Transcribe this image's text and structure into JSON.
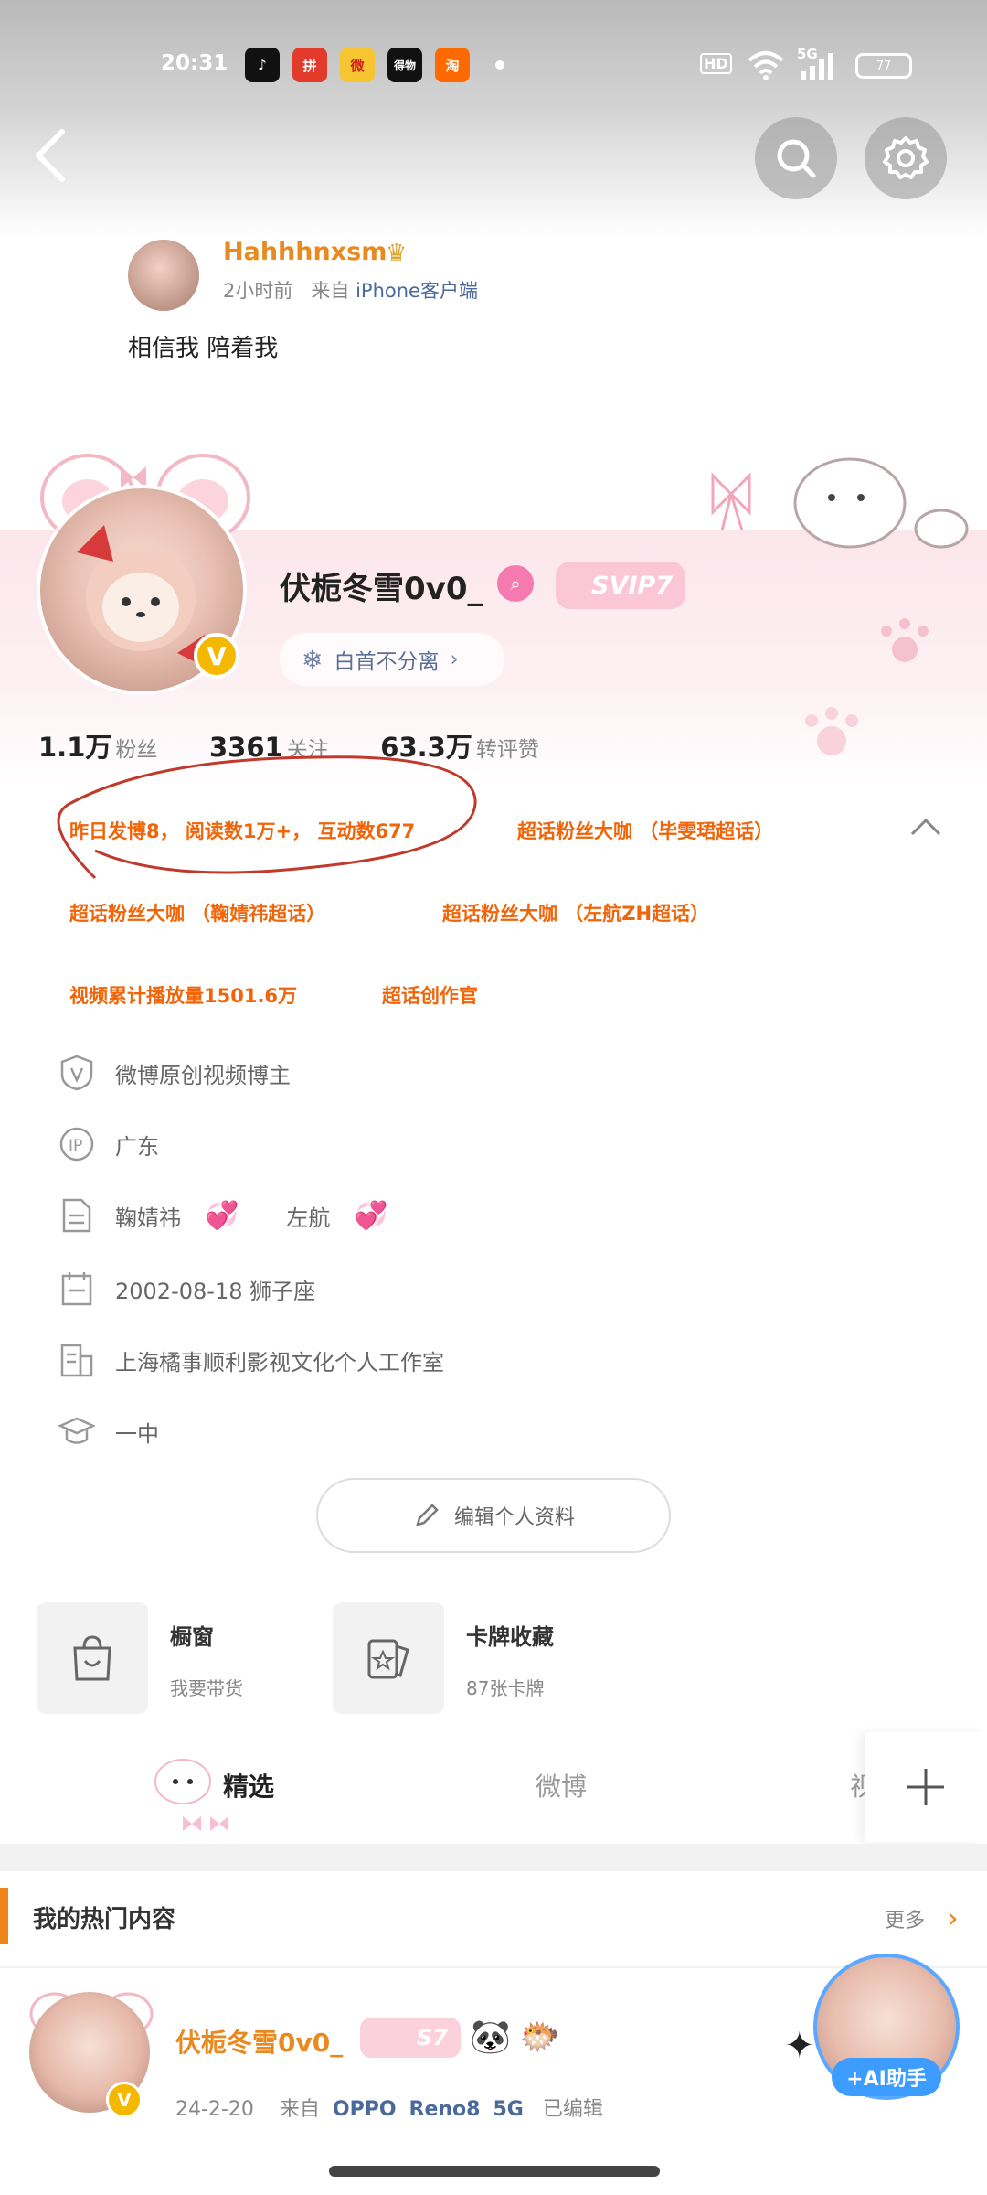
{
  "status_bar": {
    "time": "20:31",
    "apps": [
      "douyin",
      "pdd",
      "weibo",
      "dewu",
      "taobao"
    ],
    "app_glyphs": [
      "♪",
      "拼",
      "微",
      "得物",
      "淘"
    ],
    "network": "5G",
    "hd": "HD",
    "battery": "77"
  },
  "nav": {
    "back_icon": "back-arrow-icon",
    "search_icon": "search-icon",
    "settings_icon": "gear-icon"
  },
  "post_preview": {
    "author": "Hahhhnxsm",
    "time": "2小时前",
    "from_prefix": "来自",
    "client": "iPhone客户端",
    "text": "相信我 陪着我"
  },
  "profile": {
    "name": "伏栀冬雪0v0_",
    "svip": "SVIP7",
    "verified": "V",
    "pill": "白首不分离",
    "fans_num": "1.1万",
    "fans_label": "粉丝",
    "follow_num": "3361",
    "follow_label": "关注",
    "likes_num": "63.3万",
    "likes_label": "转评赞"
  },
  "tags": {
    "t1": "昨日发博8， 阅读数1万+， 互动数677",
    "t2": "超话粉丝大咖 （毕雯珺超话）",
    "t3": "超话粉丝大咖 （鞠婧祎超话）",
    "t4": "超话粉丝大咖 （左航ZH超话）",
    "t5": "视频累计播放量1501.6万",
    "t6": "超话创作官"
  },
  "info": {
    "creator": "微博原创视频博主",
    "ip": "广东",
    "likes_1": "鞠婧祎",
    "likes_2": "左航",
    "birthday": "2002-08-18 狮子座",
    "company": "上海橘事顺利影视文化个人工作室",
    "school": "一中"
  },
  "edit_button": "编辑个人资料",
  "cards": {
    "shop_title": "橱窗",
    "shop_sub": "我要带货",
    "cards_title": "卡牌收藏",
    "cards_sub": "87张卡牌"
  },
  "tabs": {
    "t1": "精选",
    "t2": "微博",
    "t3": "视"
  },
  "hot": {
    "title": "我的热门内容",
    "more": "更多"
  },
  "feed": {
    "name": "伏栀冬雪0v0_",
    "badge": "S7",
    "verified": "V",
    "date": "24-2-20",
    "from": "来自",
    "device_1": "OPPO",
    "device_2": "Reno8",
    "device_3": "5G",
    "edited": "已编辑"
  },
  "ai": {
    "label": "+AI助手"
  },
  "colors": {
    "accent_orange": "#f0650a",
    "svip_pink": "#fbc7d7",
    "link_blue": "#4a6a9c",
    "verified_gold": "#f5b800"
  }
}
